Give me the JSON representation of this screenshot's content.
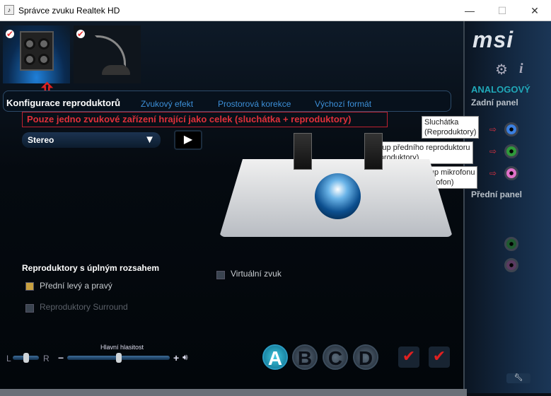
{
  "window": {
    "title": "Správce zvuku Realtek HD",
    "minimize": "—",
    "maximize": "☐",
    "close": "✕"
  },
  "devices": [
    {
      "name": "Reproduktory",
      "selected": true
    },
    {
      "name": "Mikrofon",
      "selected": false
    }
  ],
  "brand": {
    "logo": "msi"
  },
  "tabs": [
    "Konfigurace reproduktorů",
    "Zvukový efekt",
    "Prostorová korekce",
    "Výchozí formát"
  ],
  "annotation": "Pouze jedno zvukové zařízení hrající jako celek (sluchátka + reproduktory)",
  "speaker_config": {
    "selected": "Stereo",
    "play_icon": "▶"
  },
  "full_range": {
    "title": "Reproduktory s úplným rozsahem",
    "front": {
      "label": "Přední levý a pravý",
      "checked": true
    },
    "surround": {
      "label": "Reproduktory Surround",
      "checked": false
    }
  },
  "virtual": {
    "label": "Virtuální zvuk",
    "checked": false
  },
  "volume": {
    "label": "Hlavní hlasitost",
    "left": "L",
    "right": "R",
    "minus": "−",
    "plus": "+",
    "balance": 0.5,
    "level": 0.5
  },
  "profiles": [
    "A",
    "B",
    "C",
    "D"
  ],
  "right_panel": {
    "section": "ANALOGOVÝ",
    "rear": "Zadní panel",
    "front": "Přední panel",
    "jacks": [
      {
        "label": "Sluchátka",
        "sub": "(Reproduktory)",
        "color": "#3a7fe0"
      },
      {
        "label": "Výstup předního reproduktoru",
        "sub": "(Reproduktory)",
        "color": "#2f9a3a"
      },
      {
        "label": "Vstup mikrofonu",
        "sub": "(Mikrofon)",
        "color": "#e070c8"
      }
    ],
    "front_jacks": [
      {
        "color": "#1f5a30"
      },
      {
        "color": "#5a3a60"
      }
    ]
  },
  "colors": {
    "accent": "#3c8fd8",
    "annotation": "#e0303a",
    "heading": "#20a8b8"
  }
}
